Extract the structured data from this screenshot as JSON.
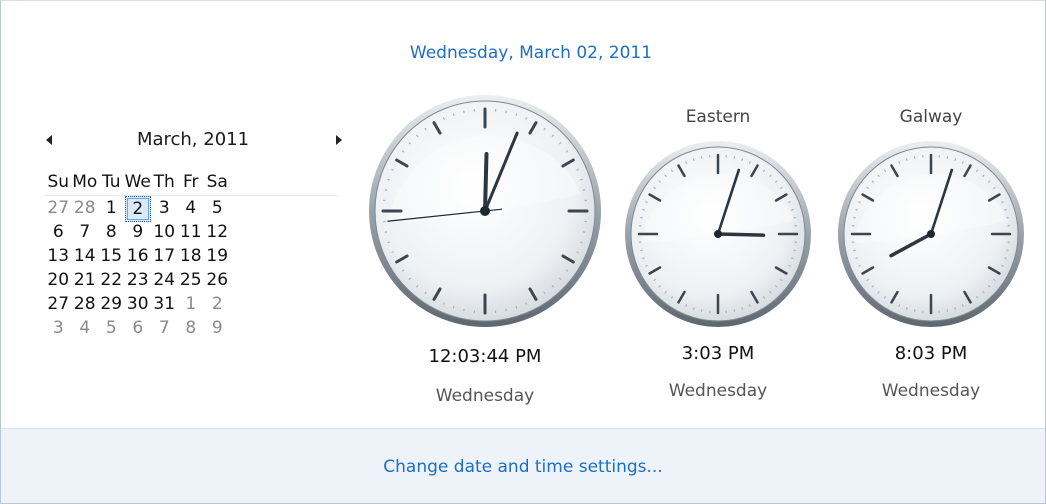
{
  "header": {
    "full_date": "Wednesday, March 02, 2011"
  },
  "calendar": {
    "month_label": "March, 2011",
    "prev_label": "previous month",
    "next_label": "next month",
    "days_of_week": [
      "Su",
      "Mo",
      "Tu",
      "We",
      "Th",
      "Fr",
      "Sa"
    ],
    "weeks": [
      [
        {
          "d": "27",
          "other": true
        },
        {
          "d": "28",
          "other": true
        },
        {
          "d": "1"
        },
        {
          "d": "2",
          "today": true
        },
        {
          "d": "3"
        },
        {
          "d": "4"
        },
        {
          "d": "5"
        }
      ],
      [
        {
          "d": "6"
        },
        {
          "d": "7"
        },
        {
          "d": "8"
        },
        {
          "d": "9"
        },
        {
          "d": "10"
        },
        {
          "d": "11"
        },
        {
          "d": "12"
        }
      ],
      [
        {
          "d": "13"
        },
        {
          "d": "14"
        },
        {
          "d": "15"
        },
        {
          "d": "16"
        },
        {
          "d": "17"
        },
        {
          "d": "18"
        },
        {
          "d": "19"
        }
      ],
      [
        {
          "d": "20"
        },
        {
          "d": "21"
        },
        {
          "d": "22"
        },
        {
          "d": "23"
        },
        {
          "d": "24"
        },
        {
          "d": "25"
        },
        {
          "d": "26"
        }
      ],
      [
        {
          "d": "27"
        },
        {
          "d": "28"
        },
        {
          "d": "29"
        },
        {
          "d": "30"
        },
        {
          "d": "31"
        },
        {
          "d": "1",
          "other": true
        },
        {
          "d": "2",
          "other": true
        }
      ],
      [
        {
          "d": "3",
          "other": true
        },
        {
          "d": "4",
          "other": true
        },
        {
          "d": "5",
          "other": true
        },
        {
          "d": "6",
          "other": true
        },
        {
          "d": "7",
          "other": true
        },
        {
          "d": "8",
          "other": true
        },
        {
          "d": "9",
          "other": true
        }
      ]
    ]
  },
  "clocks": [
    {
      "label": "",
      "time": "12:03:44 PM",
      "day": "Wednesday",
      "hour": 12,
      "minute": 3,
      "second": 44
    },
    {
      "label": "Eastern",
      "time": "3:03 PM",
      "day": "Wednesday",
      "hour": 15,
      "minute": 3
    },
    {
      "label": "Galway",
      "time": "8:03 PM",
      "day": "Wednesday",
      "hour": 20,
      "minute": 3
    }
  ],
  "footer": {
    "link_label": "Change date and time settings..."
  },
  "colors": {
    "link": "#1a6fc5",
    "header": "#1e6ec6",
    "footer_bg": "#eef3fa"
  }
}
